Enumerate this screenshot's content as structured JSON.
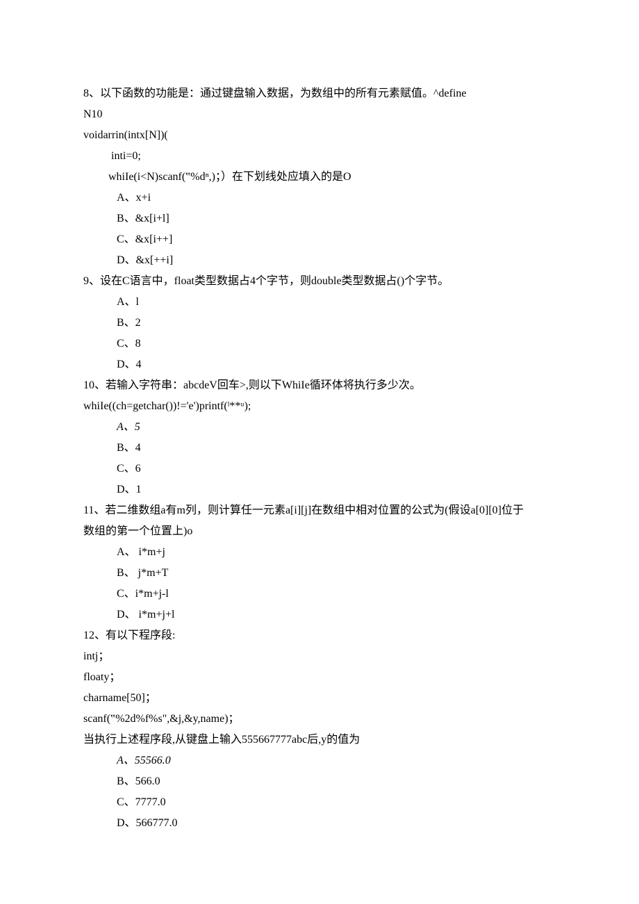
{
  "lines": [
    {
      "cls": "line",
      "text": "8、以下函数的功能是：通过键盘输入数据，为数组中的所有元素赋值。^define"
    },
    {
      "cls": "line",
      "text": "N10"
    },
    {
      "cls": "line",
      "text": "voidarrin(intx[N])("
    },
    {
      "cls": "line sub",
      "text": "  inti=0;"
    },
    {
      "cls": "line sub",
      "text": " whiIe(i<N)scanf(‟%dⁿ,)；）在下划线处应填入的是O"
    },
    {
      "cls": "opt",
      "text": "A、x+i"
    },
    {
      "cls": "opt",
      "text": "B、&x[i+l]"
    },
    {
      "cls": "opt",
      "text": "C、&x[i++]"
    },
    {
      "cls": "opt",
      "text": "D、&x[++i]"
    },
    {
      "cls": "line",
      "text": "9、设在C语言中，float类型数据占4个字节，则double类型数据占()个字节。"
    },
    {
      "cls": "opt",
      "text": "A、l"
    },
    {
      "cls": "opt",
      "text": "B、2"
    },
    {
      "cls": "opt",
      "text": "C、8"
    },
    {
      "cls": "opt",
      "text": "D、4"
    },
    {
      "cls": "line",
      "text": "10、若输入字符串：abcdeV回车>,则以下WhiIe循环体将执行多少次。"
    },
    {
      "cls": "line",
      "text": "whiIe((ch=getchar())!='e')printf(ˡ**ᵘ);"
    },
    {
      "cls": "opt italic",
      "text": "A、5"
    },
    {
      "cls": "opt",
      "text": "B、4"
    },
    {
      "cls": "opt",
      "text": "C、6"
    },
    {
      "cls": "opt",
      "text": "D、1"
    },
    {
      "cls": "line",
      "text": "11、若二维数组a有m列，则计算任一元素a[i][j]在数组中相对位置的公式为(假设a[0][0]位于"
    },
    {
      "cls": "line",
      "text": "数组的第一个位置上)o"
    },
    {
      "cls": "opt",
      "text": "A、        i*m+j"
    },
    {
      "cls": "opt",
      "text": "B、       j*m+T"
    },
    {
      "cls": "opt",
      "text": "C、i*m+j-l"
    },
    {
      "cls": "opt",
      "text": "D、       i*m+j+l"
    },
    {
      "cls": "line",
      "text": "12、有以下程序段:"
    },
    {
      "cls": "line",
      "text": "intj；"
    },
    {
      "cls": "line",
      "text": "floaty；"
    },
    {
      "cls": "line",
      "text": "charname[50]；"
    },
    {
      "cls": "line",
      "text": "scanf(‟%2d%f%s\",&j,&y,name)；"
    },
    {
      "cls": "line",
      "text": "当执行上述程序段,从键盘上输入555667777abc后,y的值为"
    },
    {
      "cls": "opt italic",
      "text": "A、55566.0"
    },
    {
      "cls": "opt",
      "text": "B、566.0"
    },
    {
      "cls": "opt",
      "text": "C、7777.0"
    },
    {
      "cls": "opt",
      "text": "D、566777.0"
    }
  ]
}
